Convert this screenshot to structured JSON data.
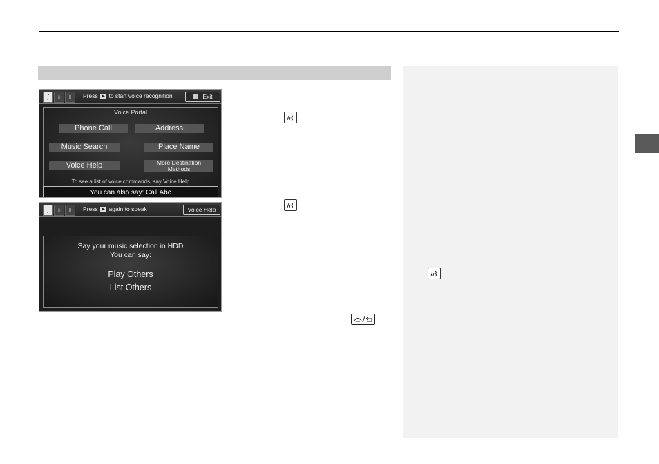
{
  "portal_screen": {
    "prompt_before": "Press",
    "prompt_after": "to start voice recognition",
    "exit_label": "Exit",
    "title": "Voice Portal",
    "options": {
      "phone_call": "Phone Call",
      "address": "Address",
      "music_search": "Music Search",
      "place_name": "Place Name",
      "voice_help": "Voice Help",
      "more_destination_line1": "More Destination",
      "more_destination_line2": "Methods"
    },
    "hint": "To see a list of voice commands, say Voice Help",
    "also_say": "You can also say: Call Abc"
  },
  "music_screen": {
    "prompt_before": "Press",
    "prompt_after": "again to speak",
    "voice_help_label": "Voice Help",
    "line1": "Say your music selection in HDD",
    "line2": "You can say:",
    "cmd1": "Play Others",
    "cmd2": "List Others"
  },
  "colors": {
    "section_bar": "#cfcfcf",
    "side_panel": "#f2f2f2",
    "side_tab": "#5a5a5a",
    "screen_bg": "#1e1e1e"
  }
}
